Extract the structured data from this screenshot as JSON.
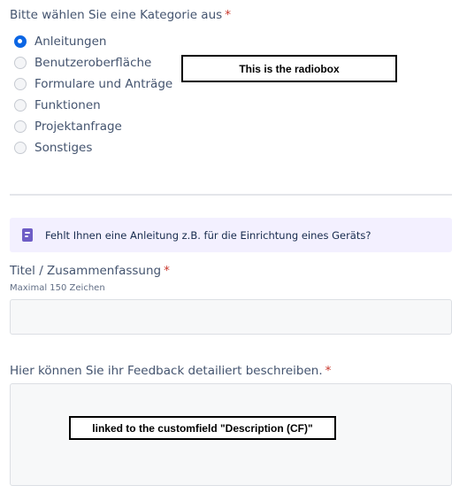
{
  "category": {
    "label": "Bitte wählen Sie eine Kategorie aus",
    "required_mark": "*",
    "options": [
      {
        "label": "Anleitungen",
        "checked": true
      },
      {
        "label": "Benutzeroberfläche",
        "checked": false
      },
      {
        "label": "Formulare und Anträge",
        "checked": false
      },
      {
        "label": "Funktionen",
        "checked": false
      },
      {
        "label": "Projektanfrage",
        "checked": false
      },
      {
        "label": "Sonstiges",
        "checked": false
      }
    ],
    "annotation": "This is the radiobox"
  },
  "info_banner": {
    "icon": "document-icon",
    "text": "Fehlt Ihnen eine Anleitung z.B. für die Einrichtung eines Geräts?"
  },
  "title_field": {
    "label": "Titel / Zusammenfassung",
    "required_mark": "*",
    "helper": "Maximal 150 Zeichen",
    "value": ""
  },
  "feedback_field": {
    "label": "Hier können Sie ihr Feedback detailiert beschreiben.",
    "required_mark": "*",
    "value": "",
    "annotation": "linked to the customfield \"Description (CF)\""
  },
  "colors": {
    "accent": "#0c66e4",
    "required": "#c9372c",
    "banner_bg": "#f3f0ff",
    "banner_icon": "#6e5dc6"
  }
}
